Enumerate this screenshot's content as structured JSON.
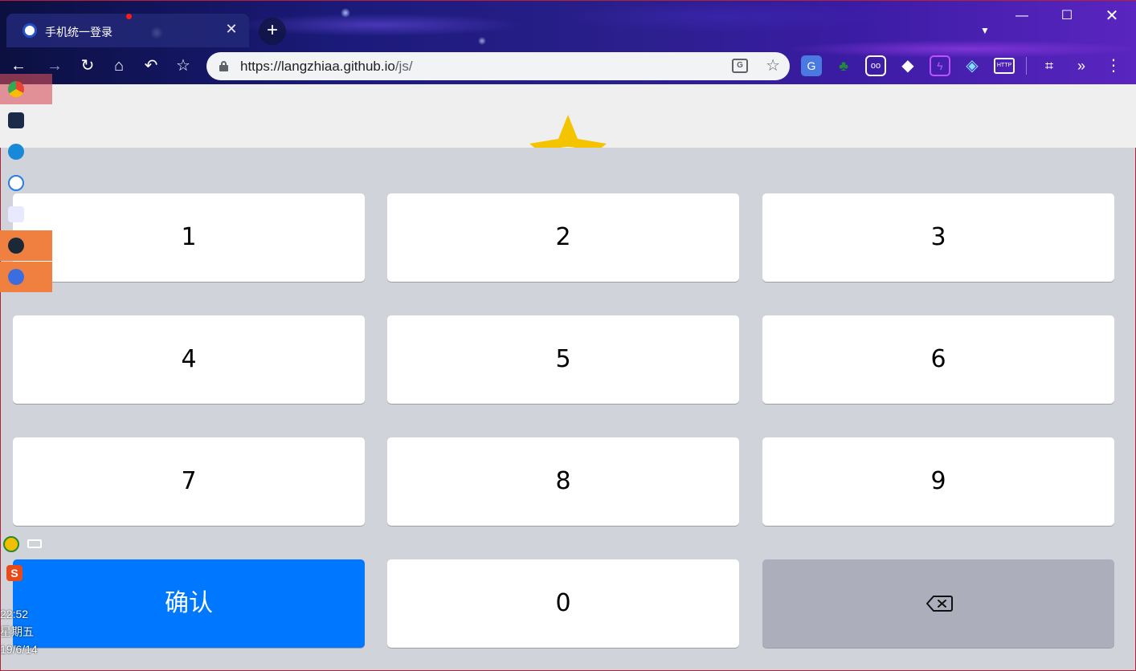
{
  "browser": {
    "tab_title": "手机统一登录",
    "url_host": "https://langzhiaa.github.io",
    "url_path": "/js/",
    "icons": {
      "back": "arrow-left-icon",
      "forward": "arrow-right-icon",
      "reload": "reload-icon",
      "home": "home-icon",
      "undo": "undo-icon",
      "bookmark": "star-icon",
      "translate": "translate-icon",
      "menu": "kebab-menu-icon"
    }
  },
  "keypad": {
    "keys": [
      "1",
      "2",
      "3",
      "4",
      "5",
      "6",
      "7",
      "8",
      "9"
    ],
    "zero": "0",
    "confirm_label": "确认",
    "confirm_color": "#0077ff",
    "delete_icon": "backspace-icon",
    "background_color": "#d0d3da"
  },
  "taskbar": {
    "time": "22:52",
    "weekday": "星期五",
    "date": "19/6/14"
  }
}
